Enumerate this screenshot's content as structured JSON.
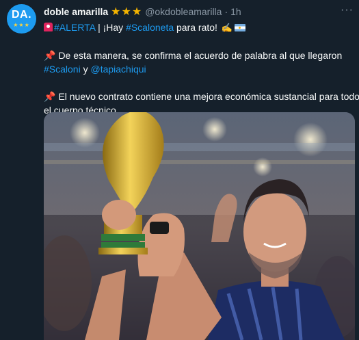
{
  "author": {
    "avatar_text": "DA.",
    "avatar_stars": "★★★",
    "name": "doble amarilla",
    "name_stars": "★★★",
    "handle": "@okdobleamarilla",
    "separator": "·",
    "time": "1h"
  },
  "menu": {
    "more_label": "···"
  },
  "tweet": {
    "line1": {
      "hashtag_alerta": "#ALERTA",
      "text_a": " | ¡Hay ",
      "hashtag_scaloneta": "#Scaloneta",
      "text_b": " para rato!"
    },
    "line2": "De esta manera, se confirma el acuerdo de palabra al que llegaron",
    "line3": {
      "hashtag_scaloni": "#Scaloni",
      "text_y": " y ",
      "mention_tapia": "@tapiachiqui"
    },
    "line4": "El nuevo contrato contiene una mejora económica sustancial para todo",
    "line5": "el cuerpo técnico"
  },
  "colors": {
    "background": "#15202b",
    "link": "#1d9bf0",
    "secondary_text": "#8b98a5",
    "verified_stars": "#f4b400"
  },
  "icons": {
    "siren": "rotating-light-icon",
    "pin": "pushpin-icon",
    "writing": "writing-hand-icon",
    "flag": "argentina-flag-icon"
  }
}
